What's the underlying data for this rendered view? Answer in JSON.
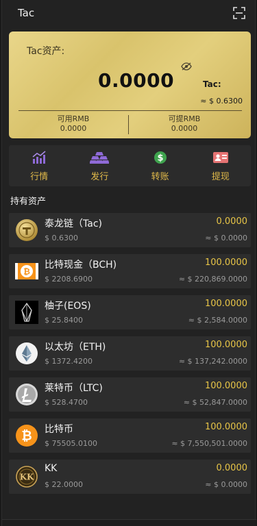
{
  "header": {
    "title": "Tac",
    "scan_icon": "scan-icon"
  },
  "card": {
    "label": "Tac资产:",
    "amount": "0.0000",
    "unit": "Tac:",
    "approx": "≈ $ 0.6300",
    "available_label": "可用RMB",
    "available_value": "0.0000",
    "withdrawable_label": "可提RMB",
    "withdrawable_value": "0.0000",
    "eye_icon": "eye-hidden-icon"
  },
  "actions": [
    {
      "label": "行情",
      "icon": "chart-icon",
      "color": "#8e6ad6"
    },
    {
      "label": "发行",
      "icon": "gold-bars-icon",
      "color": "#8e6ad6"
    },
    {
      "label": "转账",
      "icon": "dollar-coin-icon",
      "color": "#3fa44e"
    },
    {
      "label": "提现",
      "icon": "id-card-icon",
      "color": "#e57373"
    }
  ],
  "section_title": "持有资产",
  "assets": [
    {
      "name": "泰龙链（Tac)",
      "price": "$ 0.6300",
      "qty": "0.0000",
      "value": "≈ $ 0.0000",
      "icon": "tac-coin-icon"
    },
    {
      "name": "比特现金（BCH)",
      "price": "$ 2208.6900",
      "qty": "100.0000",
      "value": "≈ $ 220,869.0000",
      "icon": "bch-icon"
    },
    {
      "name": "柚子(EOS)",
      "price": "$ 25.8400",
      "qty": "100.0000",
      "value": "≈ $ 2,584.0000",
      "icon": "eos-icon"
    },
    {
      "name": "以太坊（ETH)",
      "price": "$ 1372.4200",
      "qty": "100.0000",
      "value": "≈ $ 137,242.0000",
      "icon": "eth-icon"
    },
    {
      "name": "莱特币（LTC)",
      "price": "$ 528.4700",
      "qty": "100.0000",
      "value": "≈ $ 52,847.0000",
      "icon": "ltc-icon"
    },
    {
      "name": "比特币",
      "price": "$ 75505.0100",
      "qty": "100.0000",
      "value": "≈ $ 7,550,501.0000",
      "icon": "btc-icon"
    },
    {
      "name": "KK",
      "price": "$ 22.0000",
      "qty": "0.0000",
      "value": "≈ $ 0.0000",
      "icon": "kk-coin-icon"
    }
  ]
}
